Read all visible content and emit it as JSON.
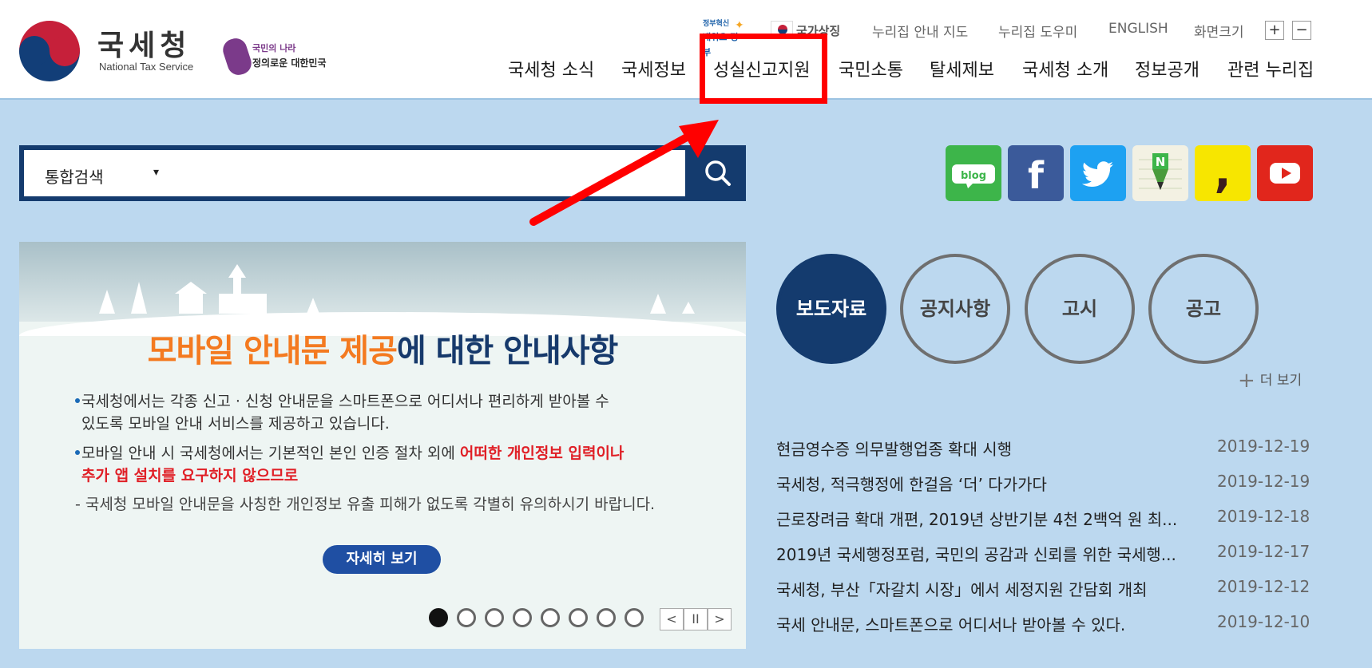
{
  "header": {
    "brand_ko": "국세청",
    "brand_en": "National Tax Service",
    "slogan_line1": "국민의 나라",
    "slogan_line2": "정의로운 대한민국",
    "badge_line1": "정부혁신",
    "badge_line2": "배워요 정부",
    "flag_label": "국가상징",
    "util_links": [
      "누리집 안내 지도",
      "누리집 도우미",
      "ENGLISH",
      "화면크기"
    ],
    "zoom_in": "+",
    "zoom_out": "−",
    "gnb": [
      "국세청 소식",
      "국세정보",
      "성실신고지원",
      "국민소통",
      "탈세제보",
      "국세청 소개",
      "정보공개",
      "관련 누리집"
    ]
  },
  "search": {
    "category": "통합검색",
    "caret": "▾",
    "placeholder": ""
  },
  "social": {
    "blog_label": "blog",
    "facebook_label": "f",
    "naverpost_label": "N",
    "kakao_label": ","
  },
  "banner": {
    "title_orange": "모바일 안내문 제공",
    "title_blue": "에 대한 안내사항",
    "line1": "국세청에서는 각종 신고 · 신청 안내문을 스마트폰으로 어디서나 편리하게 받아볼 수",
    "line2": "있도록 모바일 안내 서비스를 제공하고 있습니다.",
    "line3_plain": "모바일 안내 시 국세청에서는 기본적인 본인 인증 절차 외에 ",
    "line3_red": "어떠한 개인정보 입력이나",
    "line4_red": "추가 앱 설치를 요구하지 않으므로",
    "line5": "- 국세청 모바일 안내문을 사칭한 개인정보 유출 피해가 없도록 각별히 유의하시기 바랍니다.",
    "detail_button": "자세히 보기",
    "slide_count": 8,
    "active_slide": 1,
    "prev": "<",
    "pause": "II",
    "next": ">"
  },
  "tabs": [
    "보도자료",
    "공지사항",
    "고시",
    "공고"
  ],
  "more_label": "더 보기",
  "news": [
    {
      "title": "현금영수증 의무발행업종 확대 시행",
      "date": "2019-12-19"
    },
    {
      "title": "국세청, 적극행정에 한걸음 ‘더’ 다가가다",
      "date": "2019-12-19"
    },
    {
      "title": "근로장려금 확대 개편, 2019년 상반기분 4천 2백억 원 최...",
      "date": "2019-12-18"
    },
    {
      "title": "2019년 국세행정포럼, 국민의 공감과 신뢰를 위한 국세행...",
      "date": "2019-12-17"
    },
    {
      "title": "국세청, 부산「자갈치 시장」에서 세정지원 간담회 개최",
      "date": "2019-12-12"
    },
    {
      "title": "국세 안내문, 스마트폰으로 어디서나 받아볼 수 있다.",
      "date": "2019-12-10"
    }
  ],
  "colors": {
    "navy": "#143b6e",
    "page_bg": "#bcd8ef",
    "highlight": "#ff0000",
    "banner_orange": "#f47a20",
    "banner_red": "#e01f26"
  }
}
